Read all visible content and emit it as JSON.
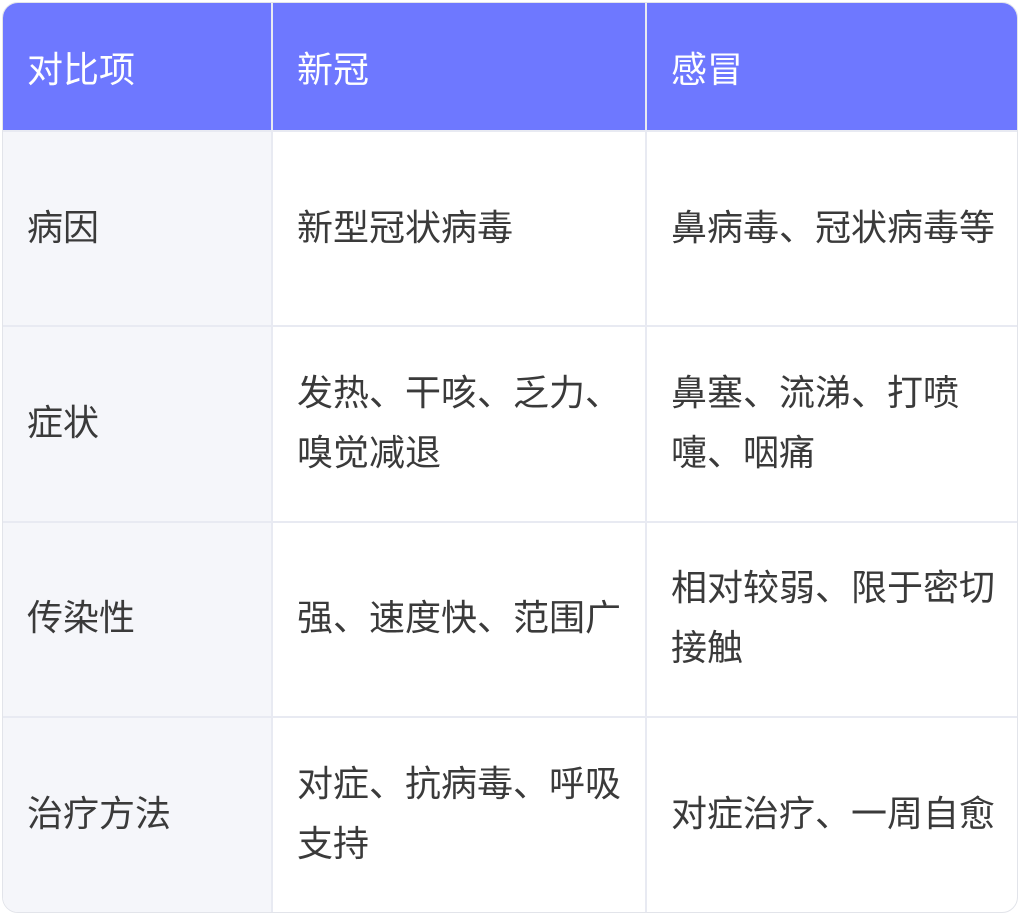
{
  "headers": [
    "对比项",
    "新冠",
    "感冒"
  ],
  "rows": [
    {
      "item": "病因",
      "covid": "新型冠状病毒",
      "cold": "鼻病毒、冠状病毒等"
    },
    {
      "item": "症状",
      "covid": "发热、干咳、乏力、嗅觉减退",
      "cold": "鼻塞、流涕、打喷嚏、咽痛"
    },
    {
      "item": "传染性",
      "covid": "强、速度快、范围广",
      "cold": "相对较弱、限于密切接触"
    },
    {
      "item": "治疗方法",
      "covid": "对症、抗病毒、呼吸支持",
      "cold": "对症治疗、一周自愈"
    }
  ]
}
